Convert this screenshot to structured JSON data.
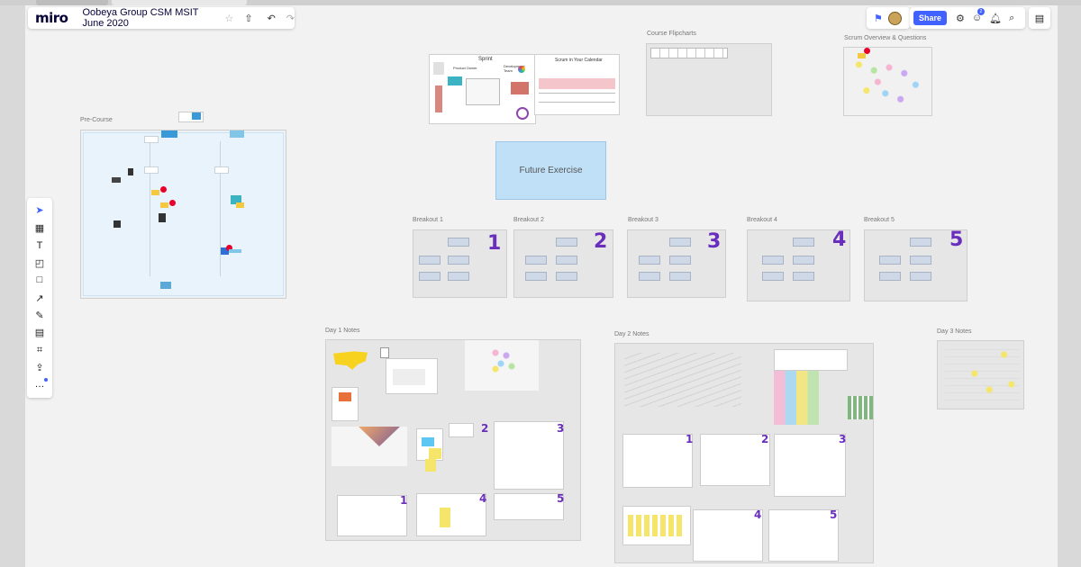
{
  "app": {
    "logo": "miro",
    "board_title": "Oobeya Group CSM MSIT June 2020"
  },
  "topbar": {
    "star_icon": "star-icon",
    "upload_icon": "upload-icon",
    "undo_icon": "undo-icon",
    "redo_icon": "redo-icon",
    "share_label": "Share",
    "avatar_badge": "2"
  },
  "frames": {
    "pre_course": "Pre-Course",
    "course_flipcharts": "Course Flipcharts",
    "scrum_overview": "Scrum Overview & Questions",
    "breakout_1": "Breakout 1",
    "breakout_2": "Breakout 2",
    "breakout_3": "Breakout 3",
    "breakout_4": "Breakout 4",
    "breakout_5": "Breakout 5",
    "day1": "Day 1 Notes",
    "day2": "Day 2 Notes",
    "day3": "Day 3 Notes"
  },
  "future_exercise": "Future Exercise",
  "breakout_numbers": [
    "1",
    "2",
    "3",
    "4",
    "5"
  ],
  "sprint_board": {
    "title": "Sprint",
    "product_owner": "Product Owner",
    "dev_team": "Development Team"
  },
  "scrum_calendar_title": "Scrum in Your Calendar",
  "toolbar": [
    {
      "name": "select-tool",
      "icon": "cursor-icon",
      "glyph": "➤"
    },
    {
      "name": "templates-tool",
      "icon": "templates-icon",
      "glyph": "▦"
    },
    {
      "name": "text-tool",
      "icon": "text-icon",
      "glyph": "T"
    },
    {
      "name": "sticky-note-tool",
      "icon": "sticky-note-icon",
      "glyph": "◰"
    },
    {
      "name": "shape-tool",
      "icon": "shape-icon",
      "glyph": "□"
    },
    {
      "name": "connection-line-tool",
      "icon": "arrow-line-icon",
      "glyph": "↗"
    },
    {
      "name": "pen-tool",
      "icon": "pen-icon",
      "glyph": "✎"
    },
    {
      "name": "comment-tool",
      "icon": "comment-icon",
      "glyph": "▤"
    },
    {
      "name": "frame-tool",
      "icon": "frame-icon",
      "glyph": "⌗"
    },
    {
      "name": "upload-tool",
      "icon": "upload-icon",
      "glyph": "⇪"
    },
    {
      "name": "more-tools",
      "icon": "more-icon",
      "glyph": "…"
    }
  ],
  "colors": {
    "accent": "#4262ff",
    "number_purple": "#6a2ebd",
    "future_blue": "#bfe0f7",
    "badge_red": "#e8002a"
  }
}
